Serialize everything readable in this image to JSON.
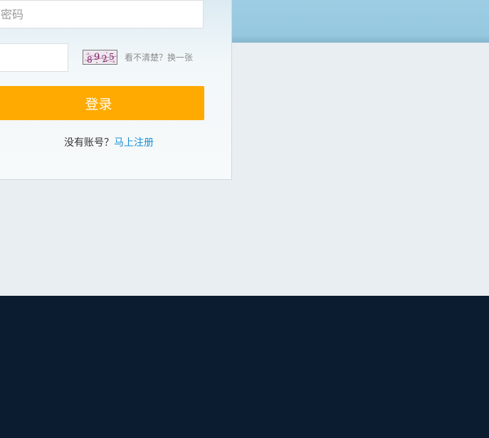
{
  "login_form": {
    "password_placeholder": "密码",
    "captcha_code": "8925",
    "refresh_captcha_label": "看不清楚？换一张",
    "login_button_label": "登录",
    "no_account_text": "没有账号？",
    "register_link_label": "马上注册"
  },
  "colors": {
    "banner": "#9ccde3",
    "page_background": "#e8eef2",
    "footer": "#0b1c31",
    "login_button": "#ffaa00",
    "register_link": "#1a8fd6"
  }
}
